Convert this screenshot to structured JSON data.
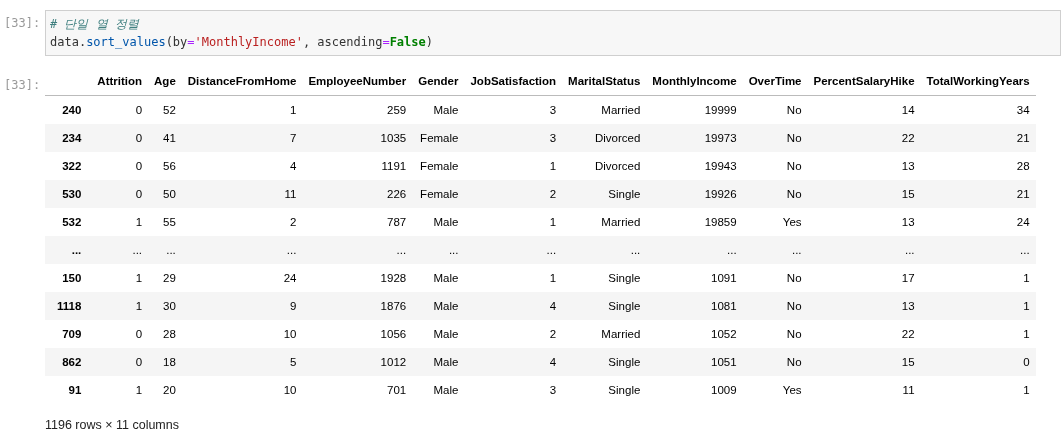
{
  "input_cell": {
    "prompt": "[33]:",
    "lines": [
      [
        {
          "kind": "comment",
          "text": "# 단일 열 정렬"
        }
      ],
      [
        {
          "kind": "plain",
          "text": "data"
        },
        {
          "kind": "plain",
          "text": "."
        },
        {
          "kind": "func",
          "text": "sort_values"
        },
        {
          "kind": "plain",
          "text": "(by"
        },
        {
          "kind": "op",
          "text": "="
        },
        {
          "kind": "string",
          "text": "'MonthlyIncome'"
        },
        {
          "kind": "plain",
          "text": ", ascending"
        },
        {
          "kind": "op",
          "text": "="
        },
        {
          "kind": "keyword",
          "text": "False"
        },
        {
          "kind": "plain",
          "text": ")"
        }
      ]
    ]
  },
  "output_cell": {
    "prompt": "[33]:",
    "table": {
      "columns": [
        "Attrition",
        "Age",
        "DistanceFromHome",
        "EmployeeNumber",
        "Gender",
        "JobSatisfaction",
        "MaritalStatus",
        "MonthlyIncome",
        "OverTime",
        "PercentSalaryHike",
        "TotalWorkingYears"
      ],
      "rows": [
        {
          "index": "240",
          "cells": [
            "0",
            "52",
            "1",
            "259",
            "Male",
            "3",
            "Married",
            "19999",
            "No",
            "14",
            "34"
          ]
        },
        {
          "index": "234",
          "cells": [
            "0",
            "41",
            "7",
            "1035",
            "Female",
            "3",
            "Divorced",
            "19973",
            "No",
            "22",
            "21"
          ]
        },
        {
          "index": "322",
          "cells": [
            "0",
            "56",
            "4",
            "1191",
            "Female",
            "1",
            "Divorced",
            "19943",
            "No",
            "13",
            "28"
          ]
        },
        {
          "index": "530",
          "cells": [
            "0",
            "50",
            "11",
            "226",
            "Female",
            "2",
            "Single",
            "19926",
            "No",
            "15",
            "21"
          ]
        },
        {
          "index": "532",
          "cells": [
            "1",
            "55",
            "2",
            "787",
            "Male",
            "1",
            "Married",
            "19859",
            "Yes",
            "13",
            "24"
          ]
        },
        {
          "index": "...",
          "cells": [
            "...",
            "...",
            "...",
            "...",
            "...",
            "...",
            "...",
            "...",
            "...",
            "...",
            "..."
          ]
        },
        {
          "index": "150",
          "cells": [
            "1",
            "29",
            "24",
            "1928",
            "Male",
            "1",
            "Single",
            "1091",
            "No",
            "17",
            "1"
          ]
        },
        {
          "index": "1118",
          "cells": [
            "1",
            "30",
            "9",
            "1876",
            "Male",
            "4",
            "Single",
            "1081",
            "No",
            "13",
            "1"
          ]
        },
        {
          "index": "709",
          "cells": [
            "0",
            "28",
            "10",
            "1056",
            "Male",
            "2",
            "Married",
            "1052",
            "No",
            "22",
            "1"
          ]
        },
        {
          "index": "862",
          "cells": [
            "0",
            "18",
            "5",
            "1012",
            "Male",
            "4",
            "Single",
            "1051",
            "No",
            "15",
            "0"
          ]
        },
        {
          "index": "91",
          "cells": [
            "1",
            "20",
            "10",
            "701",
            "Male",
            "3",
            "Single",
            "1009",
            "Yes",
            "11",
            "1"
          ]
        }
      ]
    },
    "summary": "1196 rows × 11 columns"
  }
}
